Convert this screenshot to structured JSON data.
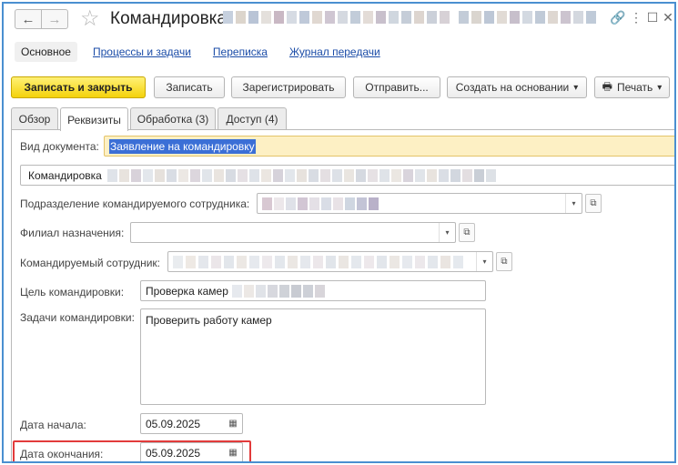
{
  "window": {
    "title": "Командировка",
    "back_icon": "←",
    "forward_icon": "→",
    "favorite_icon": "☆",
    "link_icon": "🔗",
    "more_icon": "⋮",
    "maximize_icon": "☐",
    "close_icon": "✕"
  },
  "form_nav": {
    "main": "Основное",
    "processes": "Процессы и задачи",
    "correspondence": "Переписка",
    "transfer_log": "Журнал передачи"
  },
  "toolbar": {
    "save_close": "Записать и закрыть",
    "save": "Записать",
    "register": "Зарегистрировать",
    "send": "Отправить...",
    "create_based": "Создать на основании",
    "print": "Печать",
    "dropdown_arrow": "▾",
    "print_icon": "🖶"
  },
  "tabs": {
    "overview": "Обзор",
    "requisites": "Реквизиты",
    "processing": "Обработка (3)",
    "access": "Доступ (4)"
  },
  "form": {
    "doc_type_label": "Вид документа:",
    "doc_type_value": "Заявление на командировку",
    "subject_value": "Командировка",
    "department_label": "Подразделение командируемого сотрудника:",
    "branch_label": "Филиал назначения:",
    "employee_label": "Командируемый сотрудник:",
    "purpose_label": "Цель командировки:",
    "purpose_value": "Проверка камер",
    "tasks_label": "Задачи командировки:",
    "tasks_value": "Проверить работу камер",
    "start_date_label": "Дата начала:",
    "start_date_value": "05.09.2025",
    "end_date_label": "Дата окончания:",
    "end_date_value": "05.09.2025",
    "combo_arrow": "▾",
    "open_icon": "⧉",
    "calendar_icon": "▦"
  },
  "colors": {
    "accent_border": "#4a8fd0",
    "primary_button": "#f4d20b",
    "link": "#1c4da8",
    "selection": "#3b6fd6",
    "highlight_box": "#e23b3b",
    "highlight_field": "#fdf0c4"
  }
}
